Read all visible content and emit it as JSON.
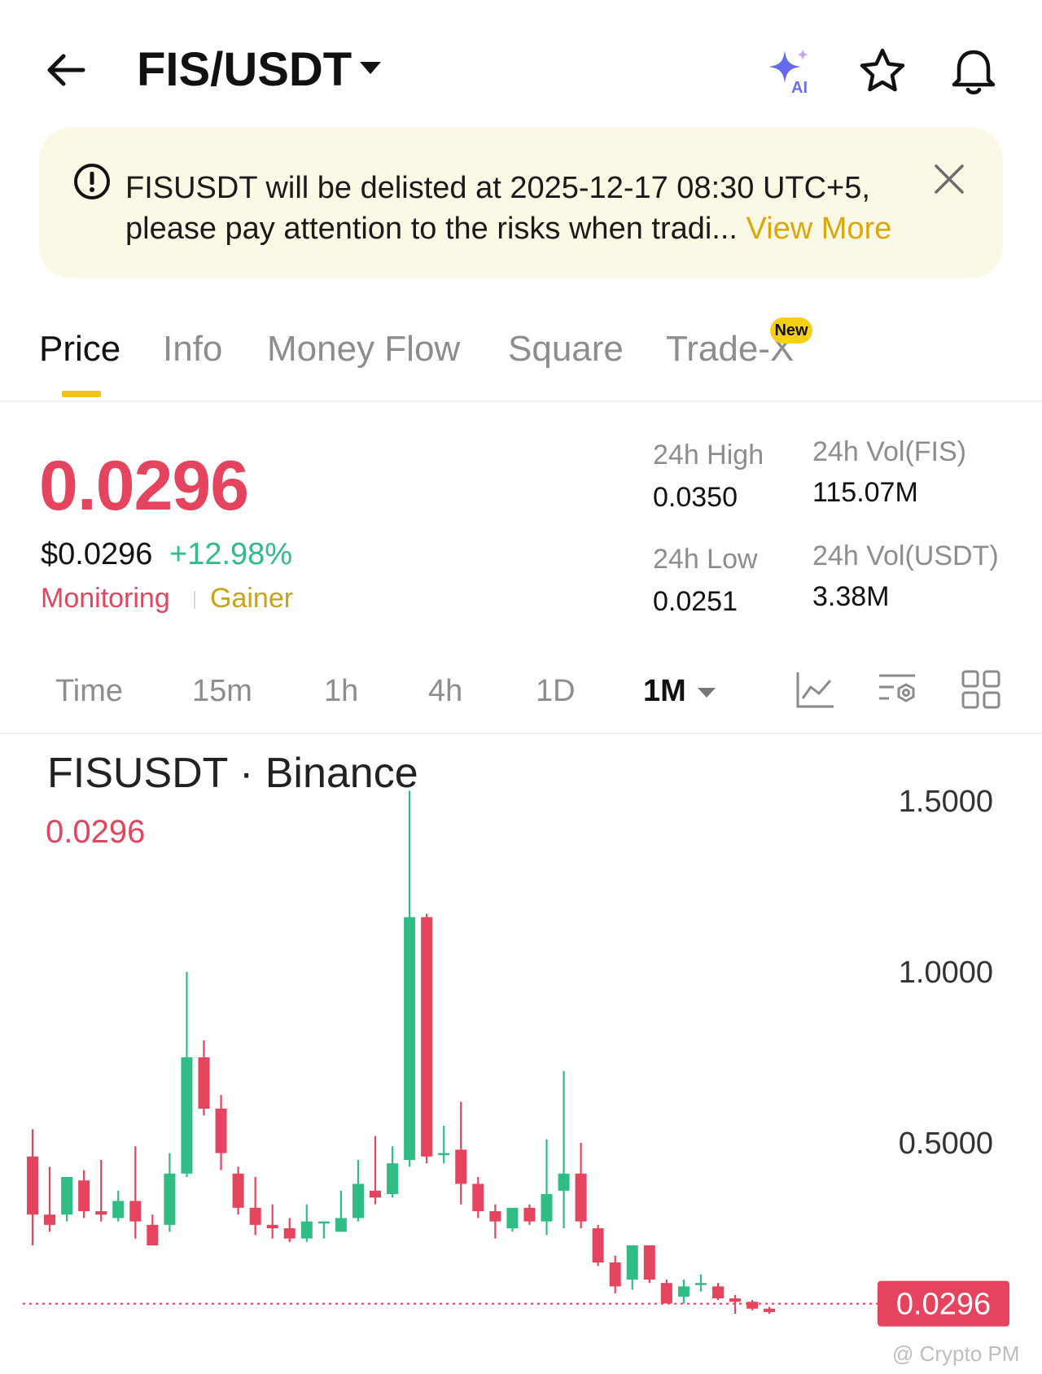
{
  "header": {
    "pair": "FIS/USDT",
    "icons": [
      "back-arrow-icon",
      "caret-down-icon",
      "ai-sparkle-icon",
      "star-icon",
      "bell-icon"
    ],
    "ai_label": "AI"
  },
  "notice": {
    "text": "FISUSDT will be delisted at 2025-12-17 08:30 UTC+5, please pay attention to the risks when tradi...",
    "link": "View More",
    "icons": [
      "info-circle-icon",
      "close-icon"
    ]
  },
  "tabs": [
    {
      "label": "Price",
      "active": true
    },
    {
      "label": "Info"
    },
    {
      "label": "Money Flow"
    },
    {
      "label": "Square"
    },
    {
      "label": "Trade-X",
      "badge": "New"
    }
  ],
  "price": {
    "last": "0.0296",
    "usd": "$0.0296",
    "change": "+12.98%",
    "tags": [
      "Monitoring",
      "Gainer"
    ],
    "up_color": "#2fbd85",
    "down_color": "#e5445f"
  },
  "stats": {
    "high_label": "24h High",
    "high_value": "0.0350",
    "low_label": "24h Low",
    "low_value": "0.0251",
    "vol_base_label": "24h Vol(FIS)",
    "vol_base_value": "115.07M",
    "vol_quote_label": "24h Vol(USDT)",
    "vol_quote_value": "3.38M"
  },
  "intervals": {
    "items": [
      "Time",
      "15m",
      "1h",
      "4h",
      "1D",
      "1M"
    ],
    "selected": "1M",
    "tool_icons": [
      "line-chart-icon",
      "indicator-settings-icon",
      "grid-layout-icon"
    ]
  },
  "chart": {
    "title": "FISUSDT · Binance",
    "last": "0.0296",
    "y_ticks": [
      "1.5000",
      "1.0000",
      "0.5000"
    ],
    "price_tag": "0.0296",
    "watermark": "@ Crypto PM"
  },
  "chart_data": {
    "type": "candlestick",
    "title": "FISUSDT · Binance",
    "interval": "1M",
    "y_ticks": [
      1.5,
      1.0,
      0.5
    ],
    "ylim": [
      0.0,
      1.65
    ],
    "last_price": 0.0296,
    "grid": false,
    "candles": [
      {
        "o": 0.46,
        "h": 0.54,
        "l": 0.2,
        "c": 0.29
      },
      {
        "o": 0.29,
        "h": 0.43,
        "l": 0.24,
        "c": 0.26
      },
      {
        "o": 0.29,
        "h": 0.39,
        "l": 0.27,
        "c": 0.4
      },
      {
        "o": 0.39,
        "h": 0.42,
        "l": 0.28,
        "c": 0.3
      },
      {
        "o": 0.3,
        "h": 0.45,
        "l": 0.27,
        "c": 0.29
      },
      {
        "o": 0.28,
        "h": 0.36,
        "l": 0.27,
        "c": 0.33
      },
      {
        "o": 0.33,
        "h": 0.49,
        "l": 0.22,
        "c": 0.27
      },
      {
        "o": 0.26,
        "h": 0.29,
        "l": 0.24,
        "c": 0.2
      },
      {
        "o": 0.26,
        "h": 0.47,
        "l": 0.24,
        "c": 0.41
      },
      {
        "o": 0.41,
        "h": 1.0,
        "l": 0.4,
        "c": 0.75
      },
      {
        "o": 0.75,
        "h": 0.8,
        "l": 0.58,
        "c": 0.6
      },
      {
        "o": 0.6,
        "h": 0.64,
        "l": 0.42,
        "c": 0.47
      },
      {
        "o": 0.41,
        "h": 0.43,
        "l": 0.29,
        "c": 0.31
      },
      {
        "o": 0.31,
        "h": 0.4,
        "l": 0.23,
        "c": 0.26
      },
      {
        "o": 0.26,
        "h": 0.32,
        "l": 0.22,
        "c": 0.25
      },
      {
        "o": 0.25,
        "h": 0.28,
        "l": 0.21,
        "c": 0.22
      },
      {
        "o": 0.22,
        "h": 0.32,
        "l": 0.21,
        "c": 0.27
      },
      {
        "o": 0.27,
        "h": 0.27,
        "l": 0.22,
        "c": 0.27
      },
      {
        "o": 0.24,
        "h": 0.36,
        "l": 0.24,
        "c": 0.28
      },
      {
        "o": 0.28,
        "h": 0.45,
        "l": 0.27,
        "c": 0.38
      },
      {
        "o": 0.36,
        "h": 0.52,
        "l": 0.32,
        "c": 0.34
      },
      {
        "o": 0.35,
        "h": 0.49,
        "l": 0.34,
        "c": 0.44
      },
      {
        "o": 0.45,
        "h": 1.53,
        "l": 0.43,
        "c": 1.16
      },
      {
        "o": 1.16,
        "h": 1.17,
        "l": 0.44,
        "c": 0.46
      },
      {
        "o": 0.47,
        "h": 0.55,
        "l": 0.44,
        "c": 0.47
      },
      {
        "o": 0.48,
        "h": 0.62,
        "l": 0.32,
        "c": 0.38
      },
      {
        "o": 0.38,
        "h": 0.4,
        "l": 0.28,
        "c": 0.3
      },
      {
        "o": 0.3,
        "h": 0.32,
        "l": 0.22,
        "c": 0.27
      },
      {
        "o": 0.25,
        "h": 0.31,
        "l": 0.24,
        "c": 0.31
      },
      {
        "o": 0.31,
        "h": 0.32,
        "l": 0.26,
        "c": 0.27
      },
      {
        "o": 0.27,
        "h": 0.51,
        "l": 0.23,
        "c": 0.35
      },
      {
        "o": 0.36,
        "h": 0.71,
        "l": 0.25,
        "c": 0.41
      },
      {
        "o": 0.41,
        "h": 0.5,
        "l": 0.25,
        "c": 0.27
      },
      {
        "o": 0.25,
        "h": 0.26,
        "l": 0.14,
        "c": 0.15
      },
      {
        "o": 0.15,
        "h": 0.17,
        "l": 0.06,
        "c": 0.08
      },
      {
        "o": 0.1,
        "h": 0.2,
        "l": 0.07,
        "c": 0.2
      },
      {
        "o": 0.2,
        "h": 0.2,
        "l": 0.09,
        "c": 0.1
      },
      {
        "o": 0.09,
        "h": 0.1,
        "l": 0.04,
        "c": 0.03
      },
      {
        "o": 0.05,
        "h": 0.1,
        "l": 0.03,
        "c": 0.08
      },
      {
        "o": 0.085,
        "h": 0.115,
        "l": 0.065,
        "c": 0.09
      },
      {
        "o": 0.08,
        "h": 0.09,
        "l": 0.04,
        "c": 0.045
      },
      {
        "o": 0.045,
        "h": 0.055,
        "l": 0.0,
        "c": 0.035
      },
      {
        "o": 0.035,
        "h": 0.04,
        "l": 0.01,
        "c": 0.015
      },
      {
        "o": 0.015,
        "h": 0.02,
        "l": 0.0,
        "c": 0.005
      }
    ]
  }
}
